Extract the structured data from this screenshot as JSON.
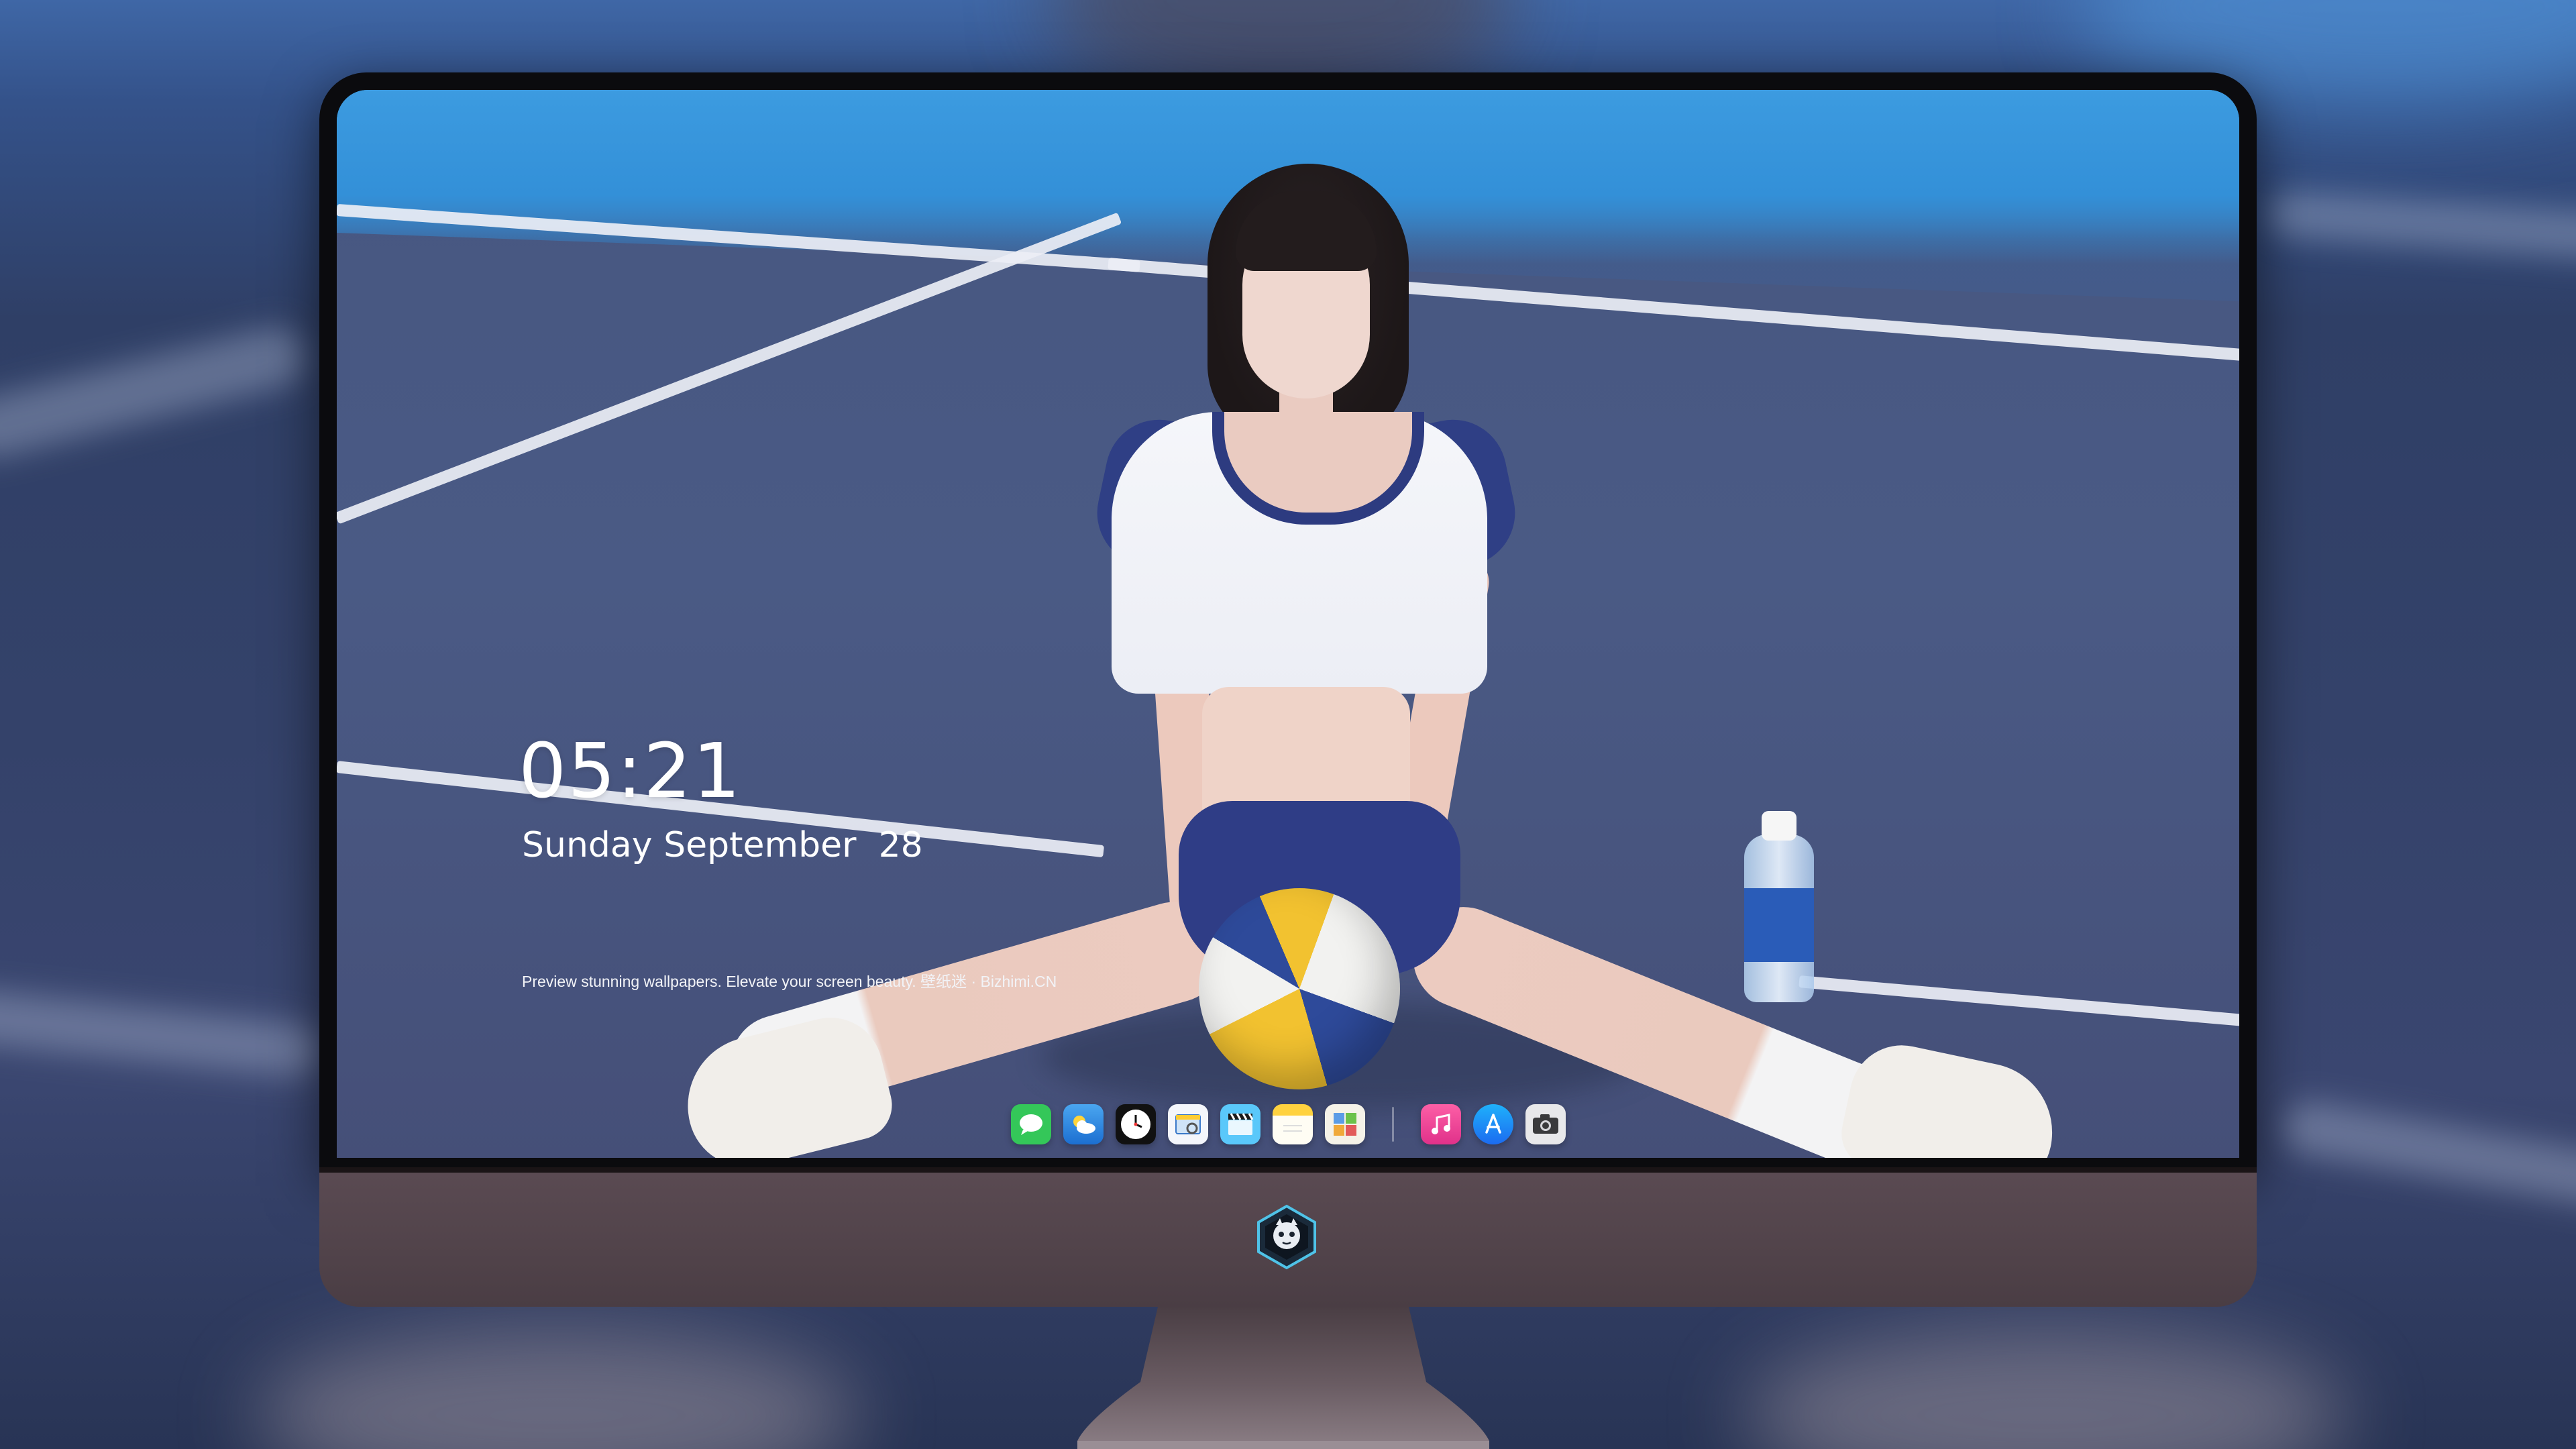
{
  "lockscreen": {
    "time": "05:21",
    "date": "Sunday September  28",
    "tagline": "Preview stunning wallpapers. Elevate your screen beauty. 壁纸迷 · Bizhimi.CN"
  },
  "dock": {
    "apps": [
      {
        "name": "messages",
        "icon": "messages-icon",
        "color": "#34c759"
      },
      {
        "name": "weather",
        "icon": "weather-icon",
        "color": "#2f8de4"
      },
      {
        "name": "clock",
        "icon": "clock-icon",
        "color": "#111111"
      },
      {
        "name": "preview",
        "icon": "preview-icon",
        "color": "#f4f6fb"
      },
      {
        "name": "clips",
        "icon": "clapperboard-icon",
        "color": "#5ac8fa"
      },
      {
        "name": "notes",
        "icon": "notes-icon",
        "color": "#ffd23f"
      },
      {
        "name": "photo-booth",
        "icon": "photo-gallery-icon",
        "color": "#f5f2e8"
      },
      {
        "name": "music",
        "icon": "music-icon",
        "color": "#fc3c8d"
      },
      {
        "name": "app-store",
        "icon": "app-store-icon",
        "color": "#1f8efa"
      },
      {
        "name": "camera",
        "icon": "camera-icon",
        "color": "#e8e8ea"
      }
    ]
  },
  "colors": {
    "bezel": "#0b0b0e",
    "chin": "#51434a",
    "court": "#475781",
    "sky_court": "#3390d8"
  }
}
